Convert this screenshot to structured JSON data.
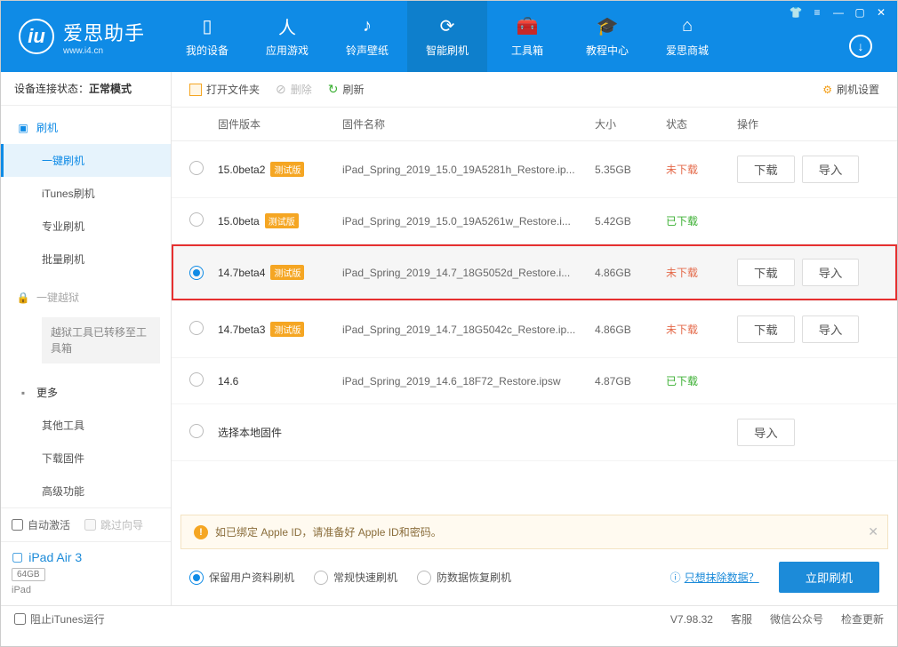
{
  "header": {
    "logo_title": "爱思助手",
    "logo_sub": "www.i4.cn",
    "tabs": [
      {
        "label": "我的设备"
      },
      {
        "label": "应用游戏"
      },
      {
        "label": "铃声壁纸"
      },
      {
        "label": "智能刷机"
      },
      {
        "label": "工具箱"
      },
      {
        "label": "教程中心"
      },
      {
        "label": "爱思商城"
      }
    ]
  },
  "sidebar": {
    "status_label": "设备连接状态：",
    "status_value": "正常模式",
    "flash_title": "刷机",
    "flash_items": [
      "一键刷机",
      "iTunes刷机",
      "专业刷机",
      "批量刷机"
    ],
    "jailbreak_title": "一键越狱",
    "jailbreak_note": "越狱工具已转移至工具箱",
    "more_title": "更多",
    "more_items": [
      "其他工具",
      "下载固件",
      "高级功能"
    ],
    "auto_activate": "自动激活",
    "skip_guide": "跳过向导",
    "device_name": "iPad Air 3",
    "device_badge": "64GB",
    "device_type": "iPad"
  },
  "toolbar": {
    "open_folder": "打开文件夹",
    "delete": "删除",
    "refresh": "刷新",
    "settings": "刷机设置"
  },
  "columns": {
    "version": "固件版本",
    "name": "固件名称",
    "size": "大小",
    "status": "状态",
    "ops": "操作"
  },
  "rows": [
    {
      "version": "15.0beta2",
      "beta": "测试版",
      "name": "iPad_Spring_2019_15.0_19A5281h_Restore.ip...",
      "size": "5.35GB",
      "status": "未下载",
      "status_type": "red",
      "download": "下载",
      "import": "导入",
      "selected": false,
      "highlighted": false
    },
    {
      "version": "15.0beta",
      "beta": "测试版",
      "name": "iPad_Spring_2019_15.0_19A5261w_Restore.i...",
      "size": "5.42GB",
      "status": "已下载",
      "status_type": "green",
      "download": "",
      "import": "",
      "selected": false,
      "highlighted": false
    },
    {
      "version": "14.7beta4",
      "beta": "测试版",
      "name": "iPad_Spring_2019_14.7_18G5052d_Restore.i...",
      "size": "4.86GB",
      "status": "未下载",
      "status_type": "red",
      "download": "下载",
      "import": "导入",
      "selected": true,
      "highlighted": true
    },
    {
      "version": "14.7beta3",
      "beta": "测试版",
      "name": "iPad_Spring_2019_14.7_18G5042c_Restore.ip...",
      "size": "4.86GB",
      "status": "未下载",
      "status_type": "red",
      "download": "下载",
      "import": "导入",
      "selected": false,
      "highlighted": false
    },
    {
      "version": "14.6",
      "beta": "",
      "name": "iPad_Spring_2019_14.6_18F72_Restore.ipsw",
      "size": "4.87GB",
      "status": "已下载",
      "status_type": "green",
      "download": "",
      "import": "",
      "selected": false,
      "highlighted": false
    },
    {
      "version": "选择本地固件",
      "beta": "",
      "name": "",
      "size": "",
      "status": "",
      "status_type": "",
      "download": "",
      "import": "导入",
      "selected": false,
      "highlighted": false
    }
  ],
  "notice": "如已绑定 Apple ID，请准备好 Apple ID和密码。",
  "flash_options": {
    "opt1": "保留用户资料刷机",
    "opt2": "常规快速刷机",
    "opt3": "防数据恢复刷机",
    "erase_link": "只想抹除数据？",
    "flash_now": "立即刷机"
  },
  "footer": {
    "block_itunes": "阻止iTunes运行",
    "version": "V7.98.32",
    "service": "客服",
    "wechat": "微信公众号",
    "check_update": "检查更新"
  }
}
